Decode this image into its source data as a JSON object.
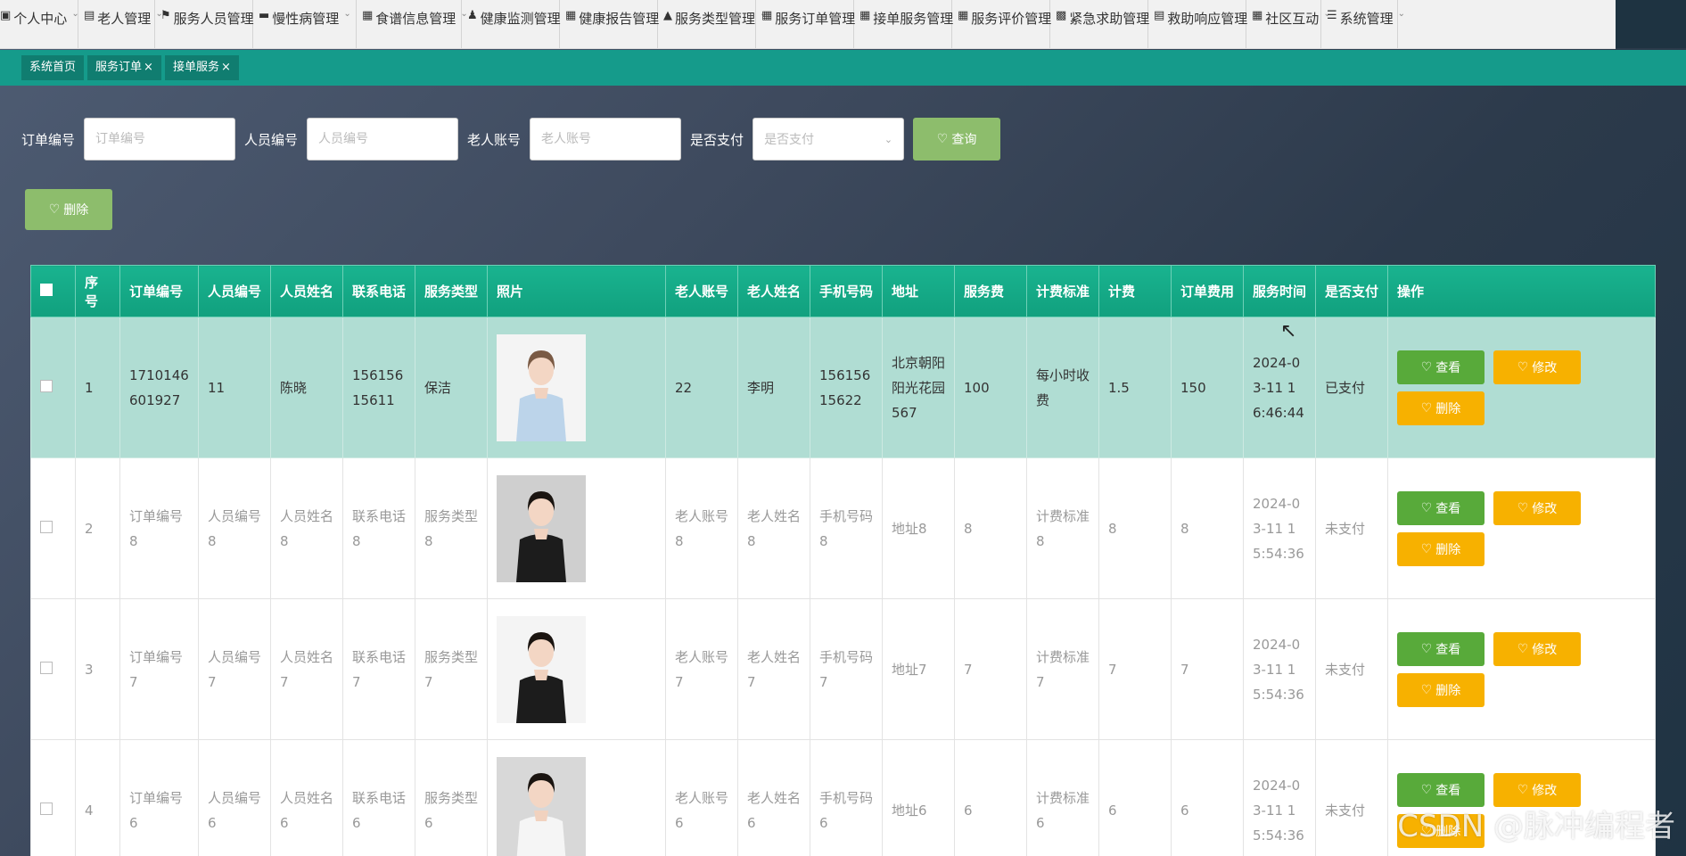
{
  "nav": [
    {
      "label": "个人中心",
      "icon": "window-icon"
    },
    {
      "label": "老人管理",
      "icon": "chart-icon"
    },
    {
      "label": "服务人员管理",
      "icon": "flag-icon"
    },
    {
      "label": "慢性病管理",
      "icon": "ticket-icon"
    },
    {
      "label": "食谱信息管理",
      "icon": "grid-icon"
    },
    {
      "label": "健康监测管理",
      "icon": "user-icon"
    },
    {
      "label": "健康报告管理",
      "icon": "grid-icon"
    },
    {
      "label": "服务类型管理",
      "icon": "sign-icon"
    },
    {
      "label": "服务订单管理",
      "icon": "grid-icon"
    },
    {
      "label": "接单服务管理",
      "icon": "grid-icon"
    },
    {
      "label": "服务评价管理",
      "icon": "grid-icon"
    },
    {
      "label": "紧急求助管理",
      "icon": "printer-icon"
    },
    {
      "label": "救助响应管理",
      "icon": "clipboard-icon"
    },
    {
      "label": "社区互动",
      "icon": "grid-icon"
    },
    {
      "label": "系统管理",
      "icon": "list-icon"
    }
  ],
  "tabs": [
    {
      "label": "系统首页",
      "closable": false
    },
    {
      "label": "服务订单",
      "closable": true
    },
    {
      "label": "接单服务",
      "closable": true
    }
  ],
  "search": {
    "order_label": "订单编号",
    "order_placeholder": "订单编号",
    "staff_label": "人员编号",
    "staff_placeholder": "人员编号",
    "elder_label": "老人账号",
    "elder_placeholder": "老人账号",
    "paid_label": "是否支付",
    "paid_placeholder": "是否支付",
    "query_label": "查询"
  },
  "batch_delete_label": "删除",
  "table": {
    "headers": [
      "序号",
      "订单编号",
      "人员编号",
      "人员姓名",
      "联系电话",
      "服务类型",
      "照片",
      "老人账号",
      "老人姓名",
      "手机号码",
      "地址",
      "服务费",
      "计费标准",
      "计费",
      "订单费用",
      "服务时间",
      "是否支付",
      "操作"
    ],
    "rows": [
      {
        "no": "1",
        "order_no": "1710146601927",
        "staff_no": "11",
        "staff_name": "陈晓",
        "phone": "15615615611",
        "service_type": "保洁",
        "photo": "photo-nurse",
        "elder_account": "22",
        "elder_name": "李明",
        "mobile": "15615615622",
        "address": "北京朝阳阳光花园567",
        "fee": "100",
        "standard": "每小时收费",
        "billing": "1.5",
        "order_cost": "150",
        "service_time": "2024-03-11 16:46:44",
        "paid": "已支付",
        "selected": true
      },
      {
        "no": "2",
        "order_no": "订单编号8",
        "staff_no": "人员编号8",
        "staff_name": "人员姓名8",
        "phone": "联系电话8",
        "service_type": "服务类型8",
        "photo": "photo-woman-dark",
        "elder_account": "老人账号8",
        "elder_name": "老人姓名8",
        "mobile": "手机号码8",
        "address": "地址8",
        "fee": "8",
        "standard": "计费标准8",
        "billing": "8",
        "order_cost": "8",
        "service_time": "2024-03-11 15:54:36",
        "paid": "未支付",
        "selected": false
      },
      {
        "no": "3",
        "order_no": "订单编号7",
        "staff_no": "人员编号7",
        "staff_name": "人员姓名7",
        "phone": "联系电话7",
        "service_type": "服务类型7",
        "photo": "photo-woman-suit",
        "elder_account": "老人账号7",
        "elder_name": "老人姓名7",
        "mobile": "手机号码7",
        "address": "地址7",
        "fee": "7",
        "standard": "计费标准7",
        "billing": "7",
        "order_cost": "7",
        "service_time": "2024-03-11 15:54:36",
        "paid": "未支付",
        "selected": false
      },
      {
        "no": "4",
        "order_no": "订单编号6",
        "staff_no": "人员编号6",
        "staff_name": "人员姓名6",
        "phone": "联系电话6",
        "service_type": "服务类型6",
        "photo": "photo-woman-white",
        "elder_account": "老人账号6",
        "elder_name": "老人姓名6",
        "mobile": "手机号码6",
        "address": "地址6",
        "fee": "6",
        "standard": "计费标准6",
        "billing": "6",
        "order_cost": "6",
        "service_time": "2024-03-11 15:54:36",
        "paid": "未支付",
        "selected": false
      }
    ],
    "actions": {
      "view": "查看",
      "edit": "修改",
      "delete": "删除"
    }
  },
  "watermark": "CSDN @脉冲编程者",
  "colors": {
    "teal": "#159b8b",
    "header_green": "#19b38f",
    "view_green": "#58aa3a",
    "edit_orange": "#f7b100",
    "query_green": "#8dbd6c",
    "selected_row": "#b0ddd3"
  }
}
